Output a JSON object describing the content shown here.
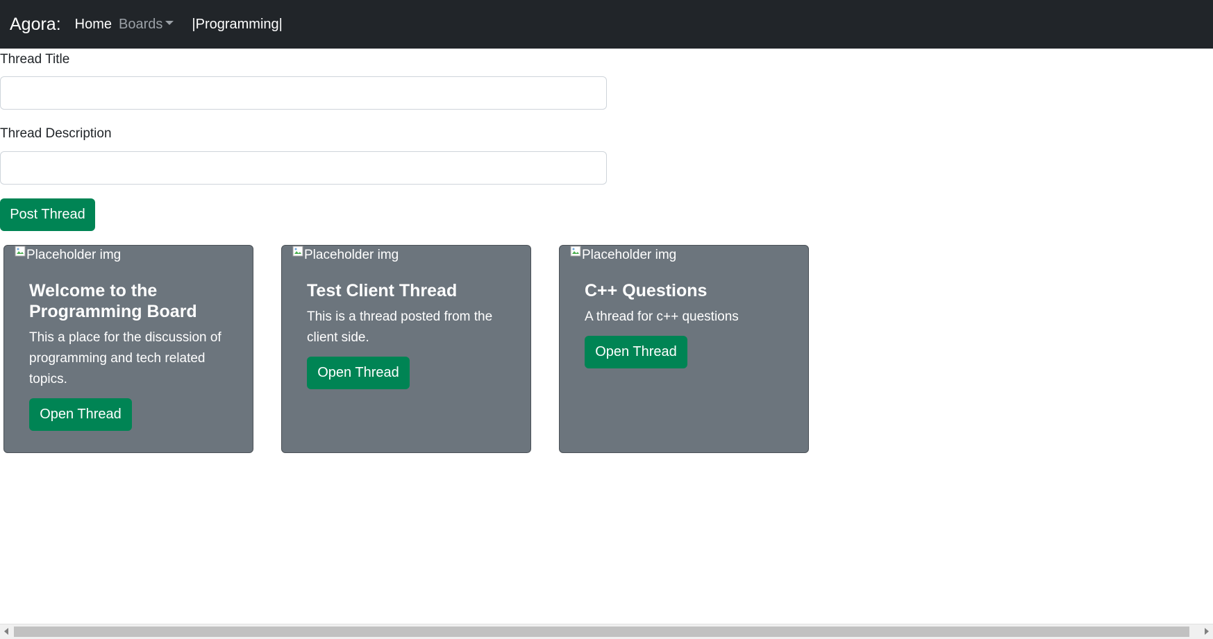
{
  "navbar": {
    "brand": "Agora:",
    "home_label": "Home",
    "boards_label": "Boards",
    "current_board": "|Programming|"
  },
  "form": {
    "title_label": "Thread Title",
    "title_value": "",
    "description_label": "Thread Description",
    "description_value": "",
    "post_button": "Post Thread"
  },
  "threads": [
    {
      "image_alt": "Placeholder img",
      "title": "Welcome to the Programming Board",
      "description": "This a place for the discussion of programming and tech related topics.",
      "button": "Open Thread"
    },
    {
      "image_alt": "Placeholder img",
      "title": "Test Client Thread",
      "description": "This is a thread posted from the client side.",
      "button": "Open Thread"
    },
    {
      "image_alt": "Placeholder img",
      "title": "C++ Questions",
      "description": "A thread for c++ questions",
      "button": "Open Thread"
    }
  ],
  "colors": {
    "navbar_bg": "#212529",
    "card_bg": "#6c757d",
    "button_green": "#008454"
  },
  "icons": {
    "broken_image": "broken-image-icon",
    "dropdown": "chevron-down-icon"
  }
}
